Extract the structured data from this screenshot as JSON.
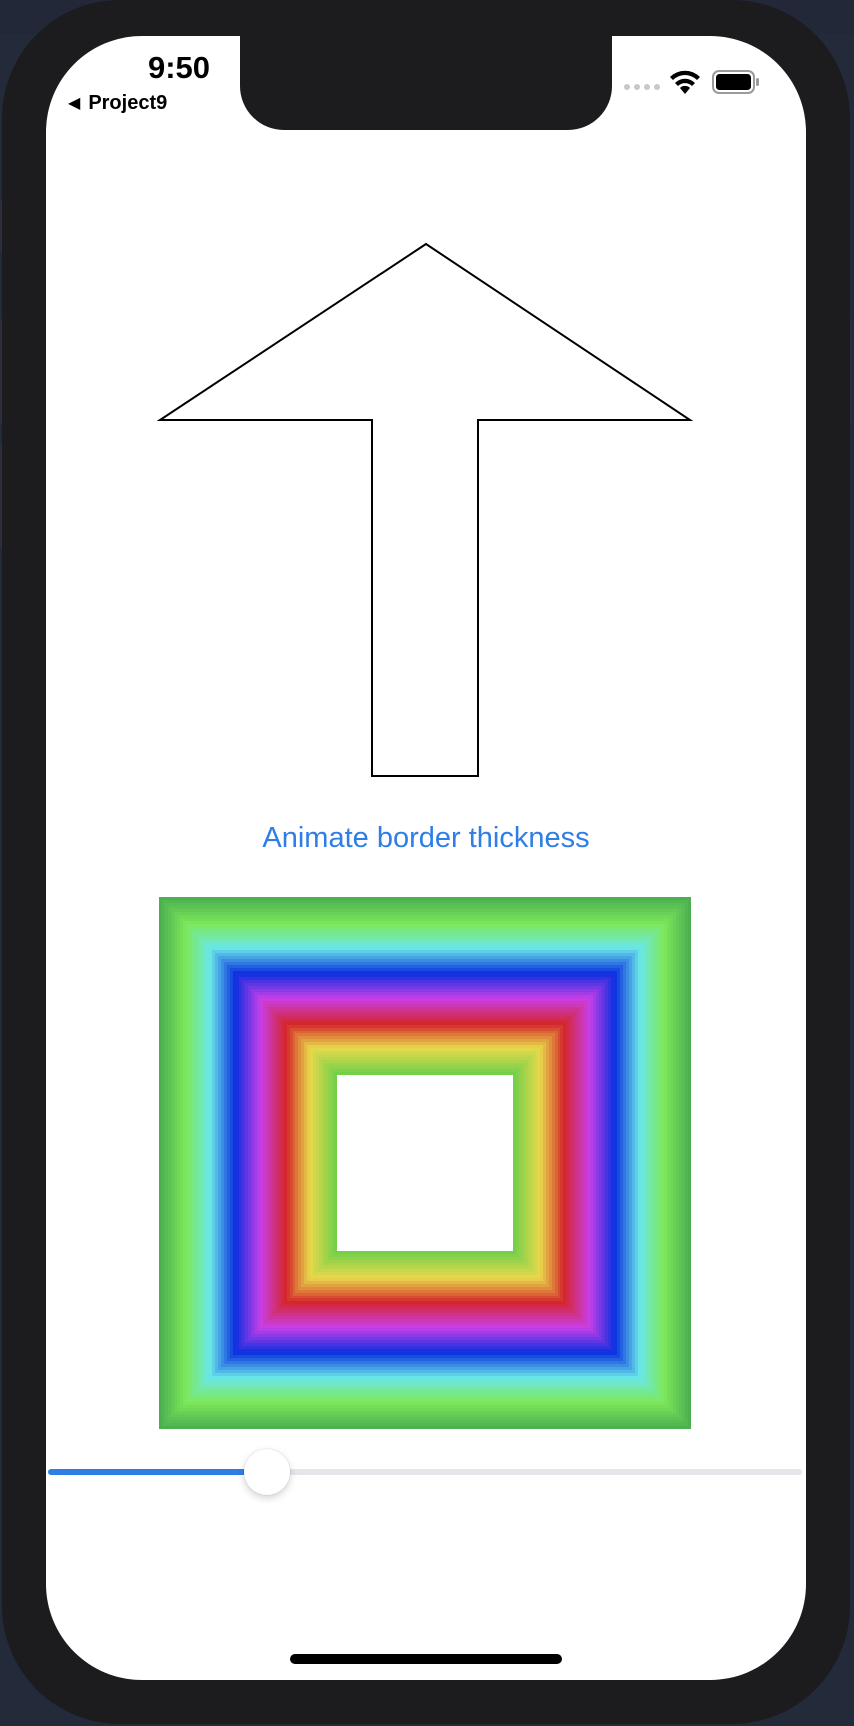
{
  "status_bar": {
    "time": "9:50",
    "signal_icon": "cellular-signal-icon",
    "wifi_icon": "wifi-icon",
    "battery_icon": "battery-icon"
  },
  "navigation": {
    "back_label": "Project9",
    "back_icon": "back-caret-icon"
  },
  "arrow_shape": {
    "icon": "up-arrow-outline",
    "stroke_color": "#000000",
    "fill_color": "#ffffff"
  },
  "animate_button": {
    "label": "Animate border thickness",
    "color": "#2f7ee6"
  },
  "gradient_square": {
    "colors": [
      "#4caf50",
      "#7de85a",
      "#6ae8e8",
      "#0a2fe0",
      "#c93fe8",
      "#d4262b",
      "#e8d94a",
      "#74d04a"
    ],
    "inner_fill": "#ffffff"
  },
  "slider": {
    "value": 0.29,
    "accent_color": "#2f7ee6"
  }
}
